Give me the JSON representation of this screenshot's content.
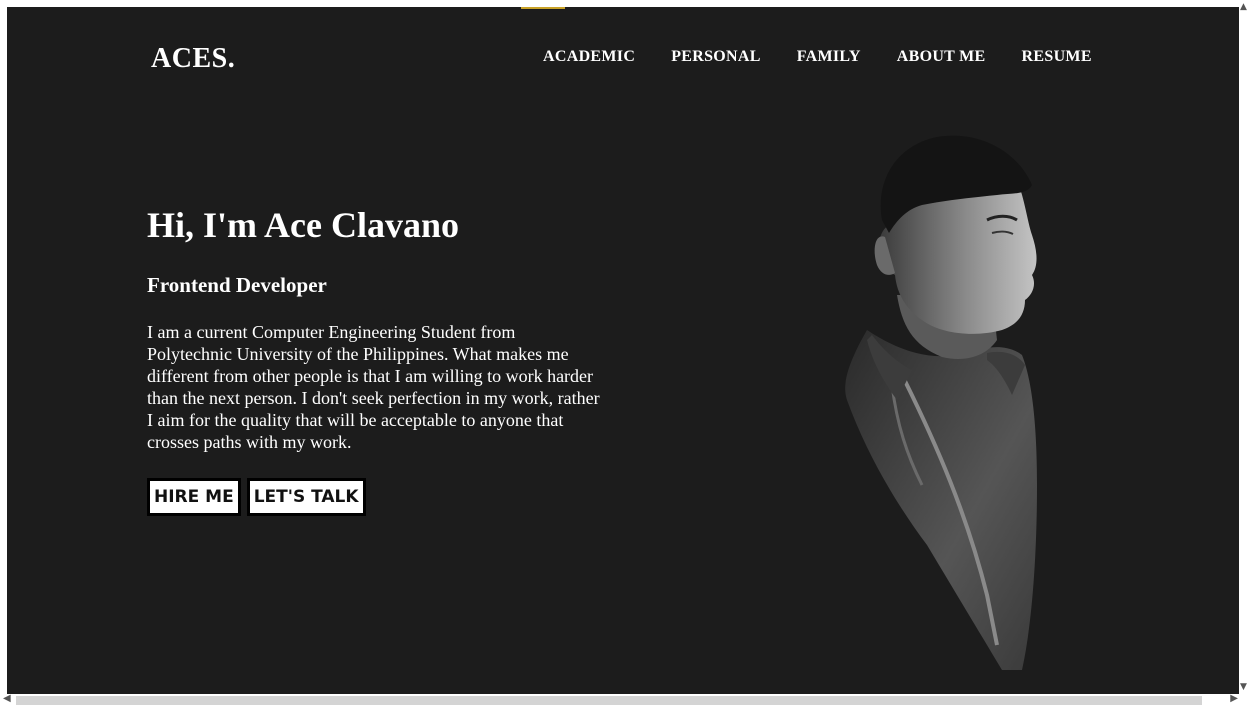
{
  "header": {
    "logo": "ACES.",
    "nav": [
      {
        "label": "ACADEMIC"
      },
      {
        "label": "PERSONAL"
      },
      {
        "label": "FAMILY"
      },
      {
        "label": "ABOUT ME"
      },
      {
        "label": "RESUME"
      }
    ]
  },
  "hero": {
    "title": "Hi, I'm Ace Clavano",
    "subtitle": "Frontend Developer",
    "description": "I am a current Computer Engineering Student from Polytechnic University of the Philippines. What makes me different from other people is that I am willing to work harder than the next person. I don't seek perfection in my work, rather I aim for the quality that will be acceptable to anyone that crosses paths with my work.",
    "buttons": {
      "hire": "HIRE ME",
      "talk": "LET'S TALK"
    }
  },
  "colors": {
    "background": "#1c1c1c",
    "text": "#ffffff",
    "accent": "#c9a227"
  },
  "icons": {
    "scroll_up": "chevron-up-icon",
    "scroll_down": "chevron-down-icon",
    "scroll_left": "chevron-left-icon",
    "scroll_right": "chevron-right-icon"
  }
}
